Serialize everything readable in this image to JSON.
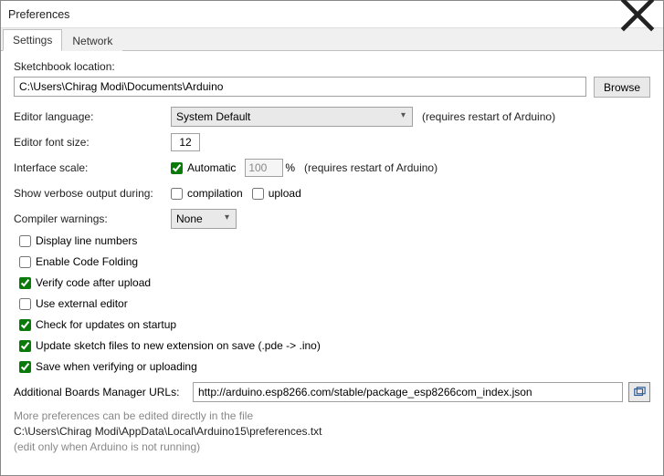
{
  "window": {
    "title": "Preferences"
  },
  "tabs": {
    "settings": "Settings",
    "network": "Network"
  },
  "sketchbook": {
    "label": "Sketchbook location:",
    "path": "C:\\Users\\Chirag Modi\\Documents\\Arduino",
    "browse": "Browse"
  },
  "editor_language": {
    "label": "Editor language:",
    "value": "System Default",
    "hint": "(requires restart of Arduino)"
  },
  "editor_font": {
    "label": "Editor font size:",
    "value": "12"
  },
  "interface_scale": {
    "label": "Interface scale:",
    "automatic": "Automatic",
    "value": "100",
    "pct": "%",
    "hint": "(requires restart of Arduino)"
  },
  "verbose": {
    "label": "Show verbose output during:",
    "compilation": "compilation",
    "upload": "upload"
  },
  "compiler_warnings": {
    "label": "Compiler warnings:",
    "value": "None"
  },
  "checks": {
    "display_line_numbers": "Display line numbers",
    "enable_code_folding": "Enable Code Folding",
    "verify_after_upload": "Verify code after upload",
    "external_editor": "Use external editor",
    "check_updates": "Check for updates on startup",
    "update_sketch_ext": "Update sketch files to new extension on save (.pde -> .ino)",
    "save_when_verifying": "Save when verifying or uploading"
  },
  "boards_urls": {
    "label": "Additional Boards Manager URLs:",
    "value": "http://arduino.esp8266.com/stable/package_esp8266com_index.json"
  },
  "footer": {
    "line1": "More preferences can be edited directly in the file",
    "path": "C:\\Users\\Chirag Modi\\AppData\\Local\\Arduino15\\preferences.txt",
    "line3": "(edit only when Arduino is not running)"
  }
}
